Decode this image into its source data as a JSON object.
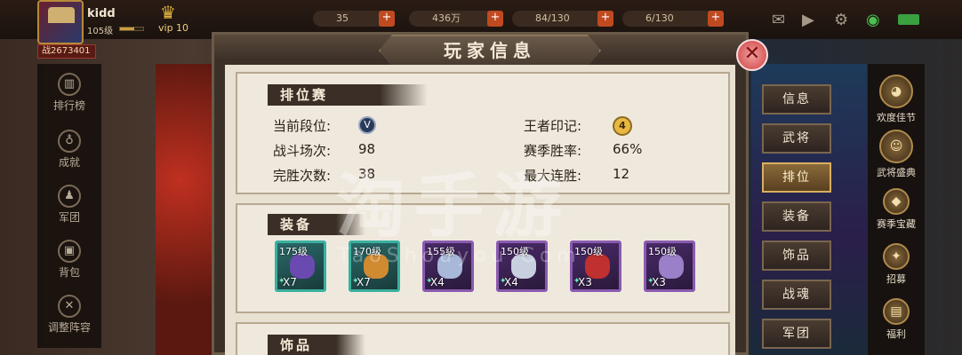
{
  "player": {
    "name": "kidd",
    "level": "105级",
    "vip": "vip 10",
    "power": "战2673401",
    "exp_fraction": 0.6
  },
  "resources": [
    {
      "value": "35"
    },
    {
      "value": "436万"
    },
    {
      "value": "84/130"
    },
    {
      "value": "6/130"
    }
  ],
  "left_menu": [
    {
      "label": "排行榜",
      "icon": "ranking-icon"
    },
    {
      "label": "成就",
      "icon": "achievement-icon"
    },
    {
      "label": "军团",
      "icon": "legion-icon"
    },
    {
      "label": "背包",
      "icon": "backpack-icon"
    },
    {
      "label": "调整阵容",
      "icon": "formation-icon"
    }
  ],
  "right_menu": [
    {
      "label": "欢度佳节",
      "icon": "festival-icon"
    },
    {
      "label": "武将盛典",
      "icon": "general-event-icon"
    },
    {
      "label": "赛季宝藏",
      "icon": "treasure-icon"
    },
    {
      "label": "招募",
      "icon": "recruit-icon"
    },
    {
      "label": "福利",
      "icon": "welfare-icon"
    }
  ],
  "dialog": {
    "title": "玩家信息",
    "ranked": {
      "heading": "排位赛",
      "current_rank_label": "当前段位:",
      "current_rank_badge": "V",
      "battles_label": "战斗场次:",
      "battles_value": "98",
      "perfect_wins_label": "完胜次数:",
      "perfect_wins_value": "38",
      "king_seal_label": "王者印记:",
      "king_seal_badge": "4",
      "win_rate_label": "赛季胜率:",
      "win_rate_value": "66%",
      "max_streak_label": "最大连胜:",
      "max_streak_value": "12"
    },
    "equipment": {
      "heading": "装备",
      "items": [
        {
          "level": "175级",
          "count": "X7",
          "quality": "teal",
          "color": "#6a4ab0"
        },
        {
          "level": "170级",
          "count": "X7",
          "quality": "teal",
          "color": "#d08a30"
        },
        {
          "level": "155级",
          "count": "X4",
          "quality": "purple",
          "color": "#a8b8d8"
        },
        {
          "level": "150级",
          "count": "X4",
          "quality": "purple",
          "color": "#c8d0e0"
        },
        {
          "level": "150级",
          "count": "X3",
          "quality": "purple",
          "color": "#c03030"
        },
        {
          "level": "150级",
          "count": "X3",
          "quality": "purple",
          "color": "#9a80c8"
        }
      ]
    },
    "accessories": {
      "heading": "饰品"
    }
  },
  "tabs": [
    {
      "label": "信息",
      "active": false
    },
    {
      "label": "武将",
      "active": false
    },
    {
      "label": "排位",
      "active": true
    },
    {
      "label": "装备",
      "active": false
    },
    {
      "label": "饰品",
      "active": false
    },
    {
      "label": "战魂",
      "active": false
    },
    {
      "label": "军团",
      "active": false
    }
  ],
  "watermark": {
    "main": "淘手游",
    "sub": "TaoShouyou.Com"
  }
}
